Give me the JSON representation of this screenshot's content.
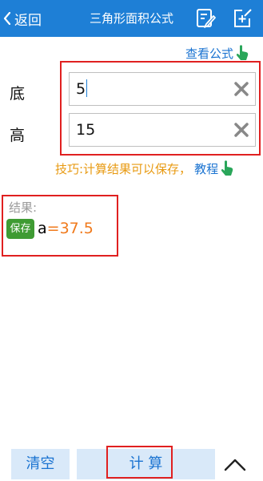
{
  "header": {
    "back_label": "返回",
    "title": "三角形面积公式",
    "edit_icon": "edit-icon",
    "new_note_icon": "new-note-icon"
  },
  "formula_link": {
    "label": "查看公式",
    "icon": "pointing-hand-icon"
  },
  "inputs": [
    {
      "label": "底",
      "value": "5"
    },
    {
      "label": "高",
      "value": "15"
    }
  ],
  "tip": {
    "text": "技巧:计算结果可以保存，",
    "link": "教程",
    "icon": "pointing-hand-icon"
  },
  "result": {
    "label": "结果:",
    "save_button": "保存",
    "var": "a",
    "equals": "=",
    "value": "37.5"
  },
  "bottom": {
    "clear_label": "清空",
    "calc_label": "计 算",
    "up_icon": "chevron-up-icon"
  },
  "colors": {
    "topbar": "#1e7fd6",
    "link": "#1a73d1",
    "tip": "#e89a12",
    "result": "#f07a1c",
    "save": "#3f9b33",
    "highlight": "#e02020"
  }
}
